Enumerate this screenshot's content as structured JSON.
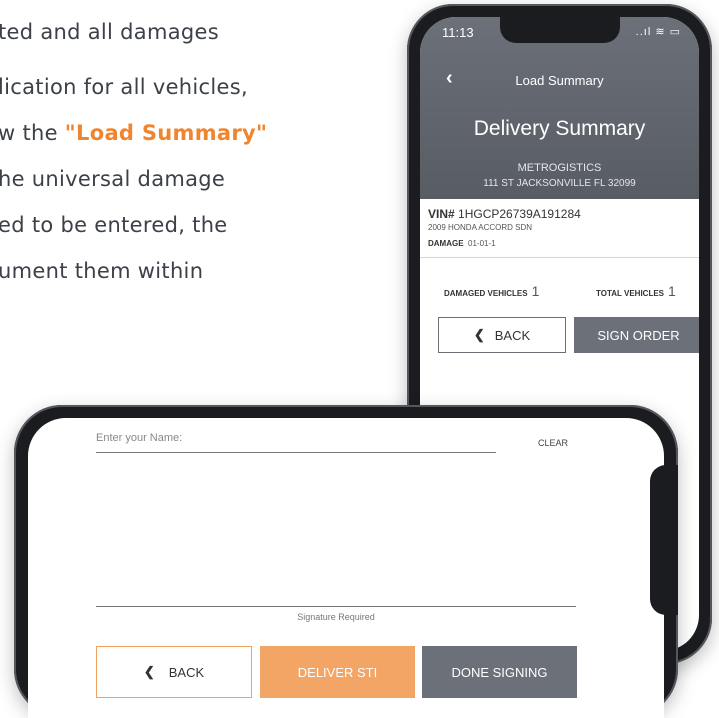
{
  "background_text": {
    "line1": "ted and all damages",
    "line2": "lication for all vehicles,",
    "line3_prefix": "w the ",
    "line3_highlight": "\"Load Summary\"",
    "line4": "he universal damage",
    "line5": "ed to be entered, the",
    "line6": "ument them within"
  },
  "portrait": {
    "status_time": "11:13",
    "status_icons": "..ıl ≋ ▭",
    "nav_back_icon": "‹",
    "nav_title": "Load Summary",
    "title": "Delivery Summary",
    "company": "METROGISTICS",
    "address": "111 ST JACKSONVILLE FL 32099",
    "vin_label": "VIN#",
    "vin": "1HGCP26739A191284",
    "vehicle": "2009 HONDA ACCORD SDN",
    "damage_label": "DAMAGE",
    "damage_code": "01-01-1",
    "damaged_vehicles_label": "DAMAGED VEHICLES",
    "damaged_vehicles_count": "1",
    "total_vehicles_label": "TOTAL VEHICLES",
    "total_vehicles_count": "1",
    "back_label": "BACK",
    "sign_order_label": "SIGN ORDER"
  },
  "landscape": {
    "name_placeholder": "Enter your Name:",
    "clear_label": "CLEAR",
    "signature_required": "Signature Required",
    "back_label": "BACK",
    "deliver_label": "DELIVER STI",
    "done_label": "DONE SIGNING"
  },
  "colors": {
    "accent_orange": "#f0852f",
    "header_gray": "#6b7079",
    "deliver_orange": "#f3a565"
  }
}
